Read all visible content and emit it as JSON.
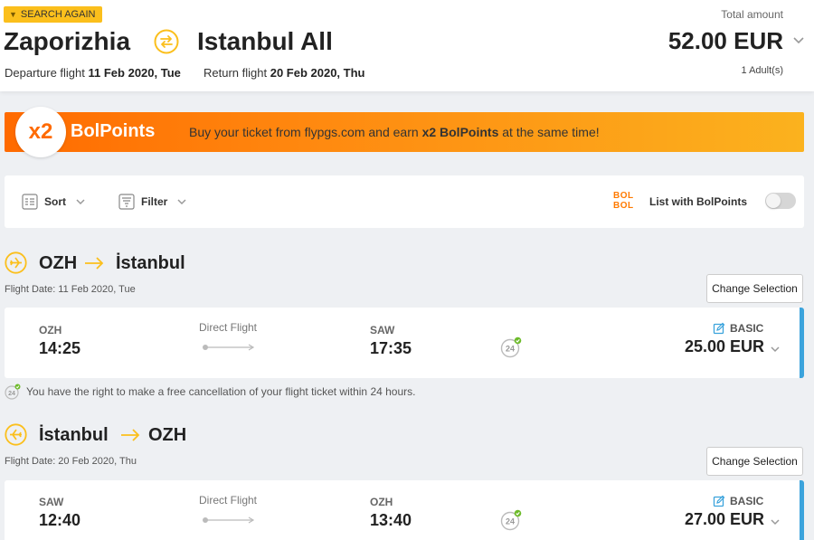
{
  "header": {
    "search_again": "SEARCH AGAIN",
    "from_city": "Zaporizhia",
    "to_city": "Istanbul All",
    "departure_label": "Departure flight",
    "departure_date": "11 Feb 2020, Tue",
    "return_label": "Return flight",
    "return_date": "20 Feb 2020, Thu",
    "total_label": "Total amount",
    "total_amount": "52.00 EUR",
    "passengers": "1 Adult(s)"
  },
  "banner": {
    "badge": "x2",
    "title": "BolPoints",
    "text_before": "Buy your ticket from flypgs.com and earn ",
    "text_bold": "x2 BolPoints",
    "text_after": " at the same time!"
  },
  "toolbar": {
    "sort_label": "Sort",
    "filter_label": "Filter",
    "bol_logo_line1": "BOL",
    "bol_logo_line2": "BOL",
    "list_bol_label": "List with BolPoints",
    "toggle_on": false
  },
  "outbound": {
    "from": "OZH",
    "to": "İstanbul",
    "flight_date": "Flight Date: 11 Feb 2020, Tue",
    "change_label": "Change Selection",
    "dep_code": "OZH",
    "dep_time": "14:25",
    "direct_label": "Direct Flight",
    "arr_code": "SAW",
    "arr_time": "17:35",
    "fare_class": "BASIC",
    "price": "25.00 EUR"
  },
  "cancellation_note": "You have the right to make a free cancellation of your flight ticket within 24 hours.",
  "inbound": {
    "from": "İstanbul",
    "to": "OZH",
    "flight_date": "Flight Date: 20 Feb 2020, Thu",
    "change_label": "Change Selection",
    "dep_code": "SAW",
    "dep_time": "12:40",
    "direct_label": "Direct Flight",
    "arr_code": "OZH",
    "arr_time": "13:40",
    "fare_class": "BASIC",
    "price": "27.00 EUR"
  },
  "colors": {
    "accent_yellow": "#fbbf1c",
    "banner_orange": "#ff6a00",
    "card_border_blue": "#3ba3dc"
  },
  "icons": [
    "chevron-down-icon",
    "swap-icon",
    "sort-icon",
    "filter-icon",
    "bolbol-logo",
    "plane-departure-icon",
    "plane-arrival-icon",
    "arrow-right-icon",
    "24h-cancel-icon",
    "edit-fare-icon"
  ]
}
